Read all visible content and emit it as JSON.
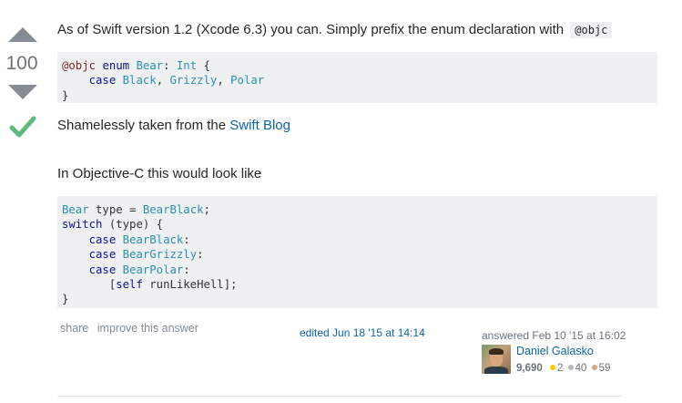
{
  "vote": {
    "count": "100"
  },
  "post": {
    "p1_text": "As of Swift version 1.2 (Xcode 6.3) you can. Simply prefix the enum declaration with",
    "p1_code": "@objc",
    "code1": {
      "line1_attr": "@objc",
      "line1_kw": "enum",
      "line1_type": "Bear",
      "line1_colon": ":",
      "line1_type2": "Int",
      "line1_brace": "{",
      "line2_kw": "case",
      "line2_items": [
        "Black",
        "Grizzly",
        "Polar"
      ],
      "line3": "}"
    },
    "p2_text": "Shamelessly taken from the",
    "p2_link": "Swift Blog",
    "p3_text": "In Objective-C this would look like",
    "code2": {
      "lines": [
        "Bear type = BearBlack;",
        "switch (type) {",
        "    case BearBlack:",
        "    case BearGrizzly:",
        "    case BearPolar:",
        "       [self runLikeHell];",
        "}"
      ]
    }
  },
  "footer": {
    "share": "share",
    "improve": "improve this answer",
    "edited": "edited Jun 18 '15 at 14:14",
    "answered": "answered Feb 10 '15 at 16:02",
    "user_name": "Daniel Galasko",
    "reputation": "9,690",
    "gold": "2",
    "silver": "40",
    "bronze": "59"
  },
  "colors": {
    "accepted": "#5eba7d",
    "link": "#0c65a5",
    "code_bg": "#eff0f1"
  }
}
